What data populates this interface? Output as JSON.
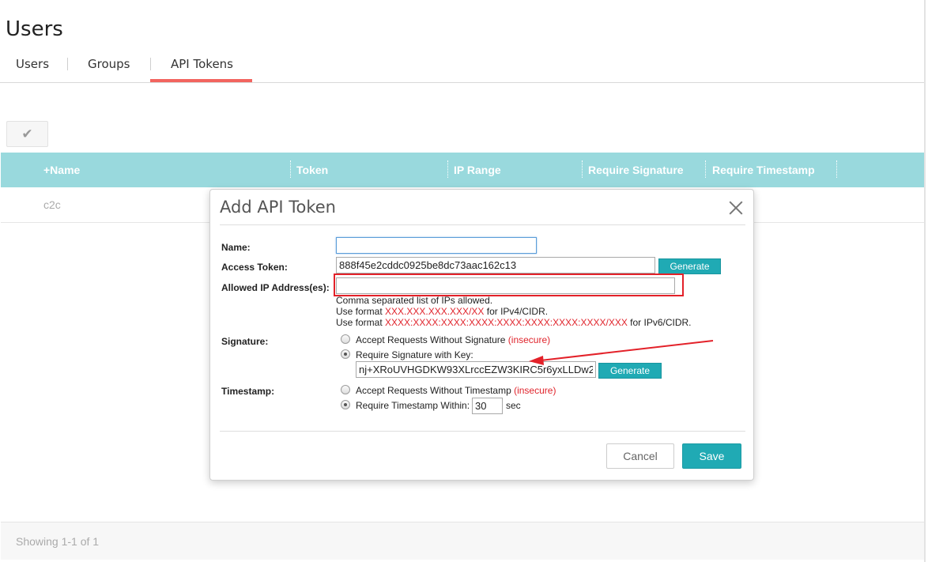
{
  "page": {
    "title": "Users"
  },
  "tabs": [
    {
      "label": "Users",
      "active": false
    },
    {
      "label": "Groups",
      "active": false
    },
    {
      "label": "API Tokens",
      "active": true
    }
  ],
  "toolbar": {
    "icon": "check-icon"
  },
  "table": {
    "columns": [
      "+Name",
      "Token",
      "IP Range",
      "Require Signature",
      "Require Timestamp"
    ],
    "rows": [
      {
        "name": "c2c"
      }
    ]
  },
  "footer": {
    "text": "Showing 1-1 of 1"
  },
  "modal": {
    "title": "Add API Token",
    "fields": {
      "name": {
        "label": "Name:",
        "value": ""
      },
      "access_token": {
        "label": "Access Token:",
        "value": "888f45e2cddc0925be8dc73aac162c13",
        "generate_label": "Generate"
      },
      "allowed_ip": {
        "label": "Allowed IP Address(es):",
        "value": ""
      }
    },
    "help": {
      "line1": "Comma separated list of IPs allowed.",
      "line2_prefix": "Use format ",
      "line2_format": "XXX.XXX.XXX.XXX/XX",
      "line2_suffix": " for IPv4/CIDR.",
      "line3_prefix": "Use format ",
      "line3_format": "XXXX:XXXX:XXXX:XXXX:XXXX:XXXX:XXXX:XXXX/XXX",
      "line3_suffix": " for IPv6/CIDR."
    },
    "signature": {
      "label": "Signature:",
      "option_accept": "Accept Requests Without Signature",
      "option_require": "Require Signature with Key:",
      "insecure": "(insecure)",
      "selected": "require",
      "key_value": "nj+XRoUVHGDKW93XLrccEZW3KIRC5r6yxLLDw2",
      "generate_label": "Generate"
    },
    "timestamp": {
      "label": "Timestamp:",
      "option_accept": "Accept Requests Without Timestamp",
      "option_require": "Require Timestamp Within:",
      "insecure": "(insecure)",
      "selected": "require",
      "seconds": "30",
      "unit": "sec"
    },
    "buttons": {
      "cancel": "Cancel",
      "save": "Save"
    }
  },
  "colors": {
    "accent": "#20aab4",
    "table_header": "#99d9dd",
    "tab_underline": "#f2645f",
    "highlight": "#e32129"
  }
}
